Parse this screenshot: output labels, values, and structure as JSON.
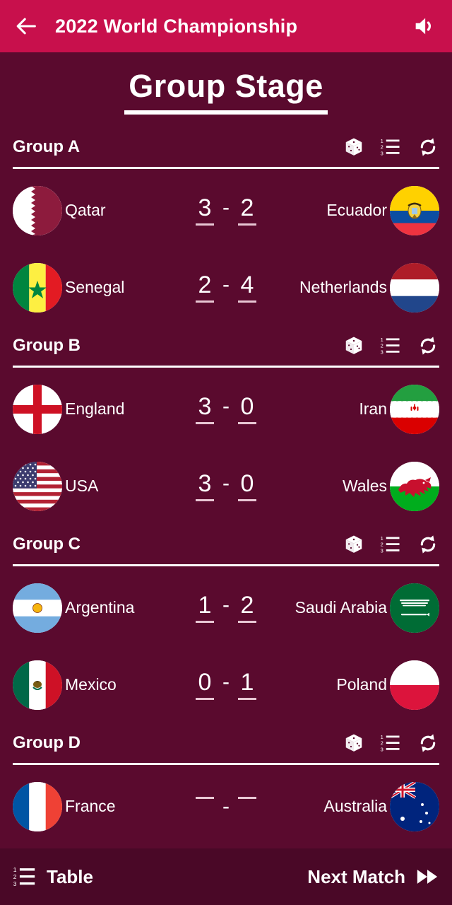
{
  "header": {
    "back_icon": "back-arrow-icon",
    "title": "2022 World Championship",
    "sound_icon": "speaker-icon"
  },
  "page": {
    "title": "Group Stage"
  },
  "group_actions": {
    "dice_label": "dice-icon",
    "table_label": "numbered-list-icon",
    "reset_label": "refresh-icon"
  },
  "score_separator": "-",
  "groups": [
    {
      "name": "Group A",
      "matches": [
        {
          "home": "Qatar",
          "home_flag": "qatar",
          "home_score": "3",
          "away_score": "2",
          "away": "Ecuador",
          "away_flag": "ecuador"
        },
        {
          "home": "Senegal",
          "home_flag": "senegal",
          "home_score": "2",
          "away_score": "4",
          "away": "Netherlands",
          "away_flag": "netherlands"
        }
      ]
    },
    {
      "name": "Group B",
      "matches": [
        {
          "home": "England",
          "home_flag": "england",
          "home_score": "3",
          "away_score": "0",
          "away": "Iran",
          "away_flag": "iran"
        },
        {
          "home": "USA",
          "home_flag": "usa",
          "home_score": "3",
          "away_score": "0",
          "away": "Wales",
          "away_flag": "wales"
        }
      ]
    },
    {
      "name": "Group C",
      "matches": [
        {
          "home": "Argentina",
          "home_flag": "argentina",
          "home_score": "1",
          "away_score": "2",
          "away": "Saudi Arabia",
          "away_flag": "saudi"
        },
        {
          "home": "Mexico",
          "home_flag": "mexico",
          "home_score": "0",
          "away_score": "1",
          "away": "Poland",
          "away_flag": "poland"
        }
      ]
    },
    {
      "name": "Group D",
      "matches": [
        {
          "home": "France",
          "home_flag": "france",
          "home_score": "",
          "away_score": "",
          "away": "Australia",
          "away_flag": "australia"
        }
      ]
    }
  ],
  "bottom": {
    "table_icon": "numbered-list-icon",
    "table_label": "Table",
    "next_label": "Next Match",
    "next_icon": "fast-forward-icon"
  },
  "colors": {
    "appbar": "#c8104c",
    "background": "#5a0a2e",
    "bottombar": "#4a0827",
    "text": "#ffffff",
    "score_underline": "#e8c7d4"
  }
}
